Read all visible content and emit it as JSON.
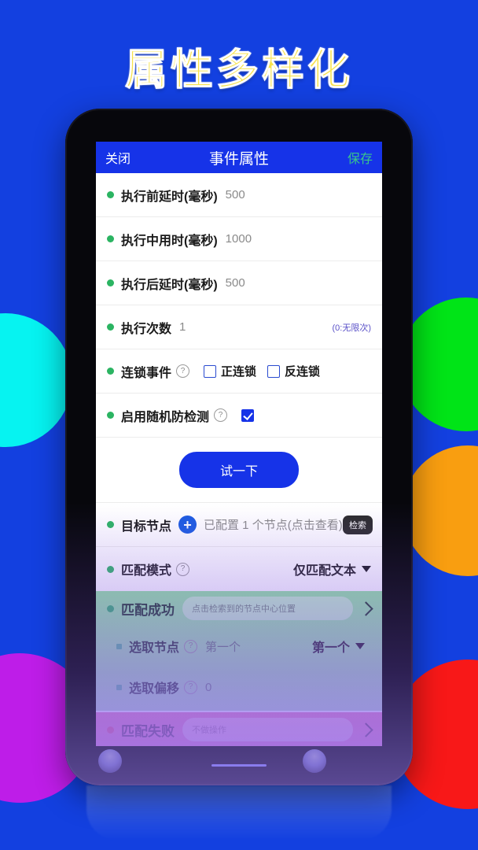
{
  "poster": {
    "title": "属性多样化",
    "title_color": "#F7E24C",
    "background_color": "#1340E0"
  },
  "background_circles": [
    {
      "name": "cyan",
      "color": "#06F3F1"
    },
    {
      "name": "magenta",
      "color": "#BE1DE8"
    },
    {
      "name": "green",
      "color": "#00E417"
    },
    {
      "name": "orange",
      "color": "#F99E10"
    },
    {
      "name": "red",
      "color": "#F81818"
    }
  ],
  "app": {
    "header": {
      "close_label": "关闭",
      "title": "事件属性",
      "save_label": "保存",
      "save_color": "#38C58C",
      "bar_color": "#1633E8"
    },
    "rows": [
      {
        "label": "执行前延时(毫秒)",
        "value": "500"
      },
      {
        "label": "执行中用时(毫秒)",
        "value": "1000"
      },
      {
        "label": "执行后延时(毫秒)",
        "value": "500"
      },
      {
        "label": "执行次数",
        "value": "1",
        "hint": "(0:无限次)"
      }
    ],
    "chain": {
      "label": "连锁事件",
      "help": "?",
      "options": [
        {
          "label": "正连锁",
          "checked": false
        },
        {
          "label": "反连锁",
          "checked": false
        }
      ]
    },
    "anti_detect": {
      "label": "启用随机防检测",
      "help": "?",
      "checked": true
    },
    "try_button": "试一下",
    "target_node": {
      "label": "目标节点",
      "add_icon": "+",
      "status": "已配置 1 个节点(点击查看)",
      "badge": "检索"
    },
    "match_mode": {
      "label": "匹配模式",
      "help": "?",
      "value": "仅匹配文本"
    },
    "success_block": {
      "title": "匹配成功",
      "action_placeholder": "点击检索到的节点中心位置",
      "rows": [
        {
          "label": "选取节点",
          "help": "?",
          "value": "第一个",
          "dropdown": "第一个"
        },
        {
          "label": "选取偏移",
          "help": "?",
          "value": "0"
        }
      ]
    },
    "fail_block": {
      "title": "匹配失败",
      "action_placeholder": "不做操作"
    }
  }
}
